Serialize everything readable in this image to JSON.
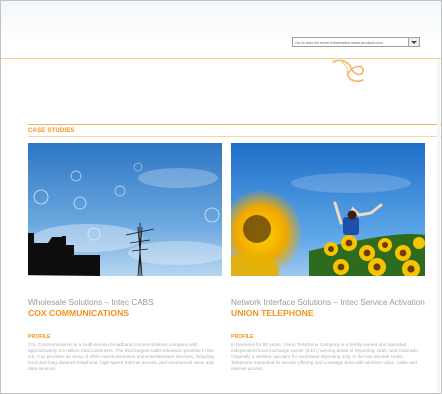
{
  "header": {
    "site_select_value": "Go to how for more information www.product.com",
    "colors": {
      "accent": "#f0931f",
      "rule": "#f3b25f"
    }
  },
  "section": {
    "title": "CASE STUDIES"
  },
  "cards": [
    {
      "subtitle": "Wholesale Solutions – Intec CABS",
      "company": "COX COMMUNICATIONS",
      "profile_label": "PROFILE",
      "profile_text": "Cox Communications is a multi-service broadband communications company with approximately 6.6 million total customers. The third-largest cable television provider in the US, Cox provides an array of other communications and entertainment services, including local and long distance telephone, high-speed Internet access, and commercial voice and data services.",
      "photo_icon": "sky-bubbles-antenna-photo"
    },
    {
      "subtitle": "Network Interface Solutions – Intec Service Activation",
      "company": "UNION TELEPHONE",
      "profile_label": "PROFILE",
      "profile_text": "In business for 90 years, Union Telephone Company is a family-owned and operated independent local exchange carrier (ILEC) serving areas of Wyoming, Utah, and Colorado. Originally a wireline operator for southwest Wyoming only, in the last decade Union Telephone expanded its service offering and coverage area with wireless voice, cable and internet access.",
      "photo_icon": "sunflower-field-photo"
    }
  ]
}
